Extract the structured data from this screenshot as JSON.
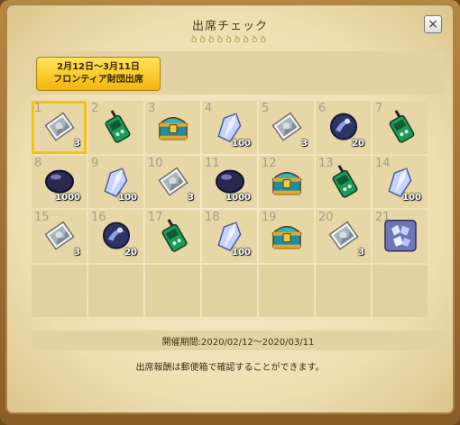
{
  "window": {
    "title": "出席チェック",
    "title_deco": "ꝺꝺꝺꝺꝺꝺꝺꝺꝺ",
    "close_label": "×"
  },
  "event": {
    "line1": "2月12日～3月11日",
    "line2": "フロンティア財団出席"
  },
  "days": [
    {
      "day": "1",
      "item": "photo-icon",
      "qty": "3"
    },
    {
      "day": "2",
      "item": "radio-icon",
      "qty": ""
    },
    {
      "day": "3",
      "item": "chest-icon",
      "qty": ""
    },
    {
      "day": "4",
      "item": "crystal-icon",
      "qty": "100"
    },
    {
      "day": "5",
      "item": "photo-icon",
      "qty": "3"
    },
    {
      "day": "6",
      "item": "dark-orb-icon",
      "qty": "20"
    },
    {
      "day": "7",
      "item": "radio-icon",
      "qty": ""
    },
    {
      "day": "8",
      "item": "dark-stone-icon",
      "qty": "1000"
    },
    {
      "day": "9",
      "item": "crystal-icon",
      "qty": "100"
    },
    {
      "day": "10",
      "item": "photo-icon",
      "qty": "3"
    },
    {
      "day": "11",
      "item": "dark-stone-icon",
      "qty": "1000"
    },
    {
      "day": "12",
      "item": "chest-icon",
      "qty": ""
    },
    {
      "day": "13",
      "item": "radio-icon",
      "qty": ""
    },
    {
      "day": "14",
      "item": "crystal-icon",
      "qty": "100"
    },
    {
      "day": "15",
      "item": "photo-icon",
      "qty": "3"
    },
    {
      "day": "16",
      "item": "dark-orb-icon",
      "qty": "20"
    },
    {
      "day": "17",
      "item": "radio-icon",
      "qty": ""
    },
    {
      "day": "18",
      "item": "crystal-icon",
      "qty": "100"
    },
    {
      "day": "19",
      "item": "chest-icon",
      "qty": ""
    },
    {
      "day": "20",
      "item": "photo-icon",
      "qty": "3"
    },
    {
      "day": "21",
      "item": "crystal-bundle-icon",
      "qty": ""
    }
  ],
  "selected_day": "1",
  "empty_cells": 7,
  "footer": {
    "period": "開催期間:2020/02/12～2020/03/11",
    "note": "出席報酬は郵便箱で確認することができます。"
  },
  "colors": {
    "accent": "#f2c317",
    "parchment": "#efe0b3",
    "frame": "#8a5d27"
  }
}
